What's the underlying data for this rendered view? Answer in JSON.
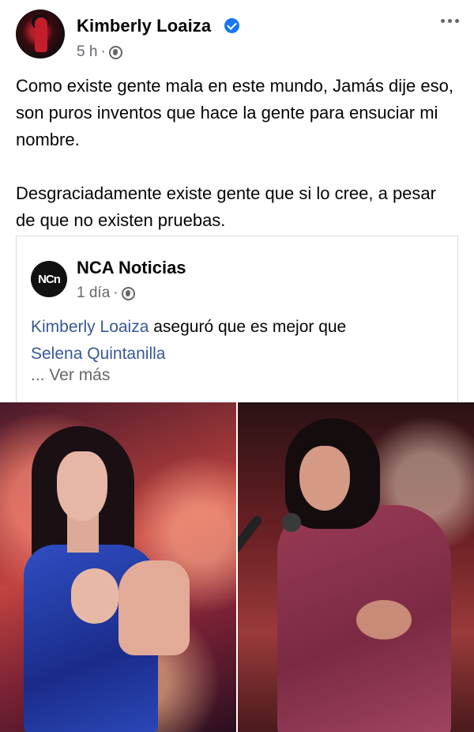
{
  "post": {
    "author": "Kimberly Loaiza",
    "time": "5 h",
    "separator": "·",
    "paragraphs": [
      "Como existe gente mala en este mundo, Jamás dije eso, son puros inventos que hace la gente para ensuciar mi nombre.",
      "Desgraciadamente existe gente que si lo cree, a pesar de que no existen pruebas."
    ]
  },
  "shared": {
    "logo_text": "NCn",
    "name": "NCA Noticias",
    "time": "1 día",
    "separator": "·",
    "link1": "Kimberly Loaiza",
    "middle": " aseguró que es mejor que ",
    "link2": "Selena Quintanilla",
    "see_more": "... Ver más"
  },
  "icons": {
    "verified": "verified-badge-icon",
    "audience": "globe-icon",
    "more": "more-options-icon"
  },
  "colors": {
    "link": "#385898",
    "verified": "#1877f2",
    "meta": "#65676b"
  }
}
